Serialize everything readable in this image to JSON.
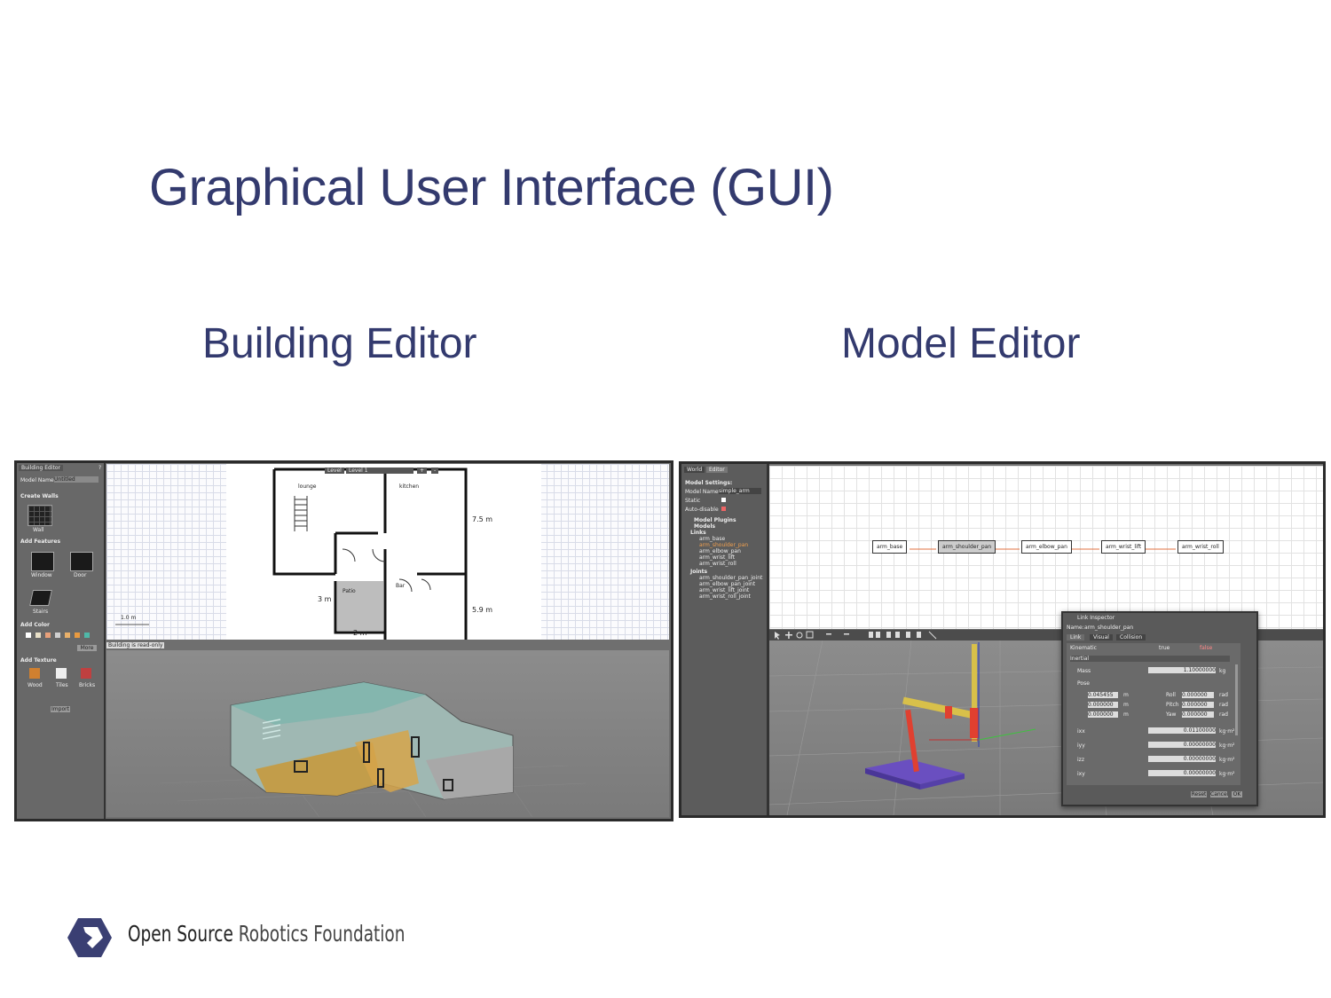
{
  "slide": {
    "title": "Graphical User Interface (GUI)",
    "left_caption": "Building Editor",
    "right_caption": "Model Editor"
  },
  "building_editor": {
    "tabs": [
      "Building Editor",
      "?"
    ],
    "model_name_label": "Model Name:",
    "model_name_value": "Untitled",
    "sections": {
      "create_walls": "Create Walls",
      "wall_item": "Wall",
      "add_features": "Add Features",
      "window": "Window",
      "door": "Door",
      "stairs": "Stairs",
      "add_color": "Add Color",
      "more_button": "More",
      "add_texture": "Add Texture",
      "textures": [
        "Wood",
        "Tiles",
        "Bricks"
      ],
      "import_button": "Import"
    },
    "level_controls": [
      "Level",
      "Level 1",
      "+",
      "-"
    ],
    "room_labels": [
      "lounge",
      "kitchen",
      "Patio",
      "Bar"
    ],
    "dimensions": [
      "7.5 m",
      "5.9 m",
      "3 m",
      "2 m"
    ],
    "scale_label": "1.0 m",
    "status": "Building is read-only",
    "colors": [
      "#ffffff",
      "#e9e0c8",
      "#e8a07a",
      "#d0d0d0",
      "#e8b06a",
      "#e89a40",
      "#4fb8a8"
    ]
  },
  "model_editor": {
    "tabs": [
      "World",
      "Editor"
    ],
    "settings_title": "Model Settings:",
    "model_name_label": "Model Name:",
    "model_name_value": "simple_arm",
    "static_label": "Static",
    "autodisable_label": "Auto-disable",
    "tree": {
      "model_plugins": "Model Plugins",
      "models": "Models",
      "links_label": "Links",
      "links": [
        "arm_base",
        "arm_shoulder_pan",
        "arm_elbow_pan",
        "arm_wrist_lift",
        "arm_wrist_roll"
      ],
      "joints_label": "Joints",
      "joints": [
        "arm_shoulder_pan_joint",
        "arm_elbow_pan_joint",
        "arm_wrist_lift_joint",
        "arm_wrist_roll_joint"
      ]
    },
    "graph_nodes": [
      "arm_base",
      "arm_shoulder_pan",
      "arm_elbow_pan",
      "arm_wrist_lift",
      "arm_wrist_roll"
    ],
    "inspector": {
      "title": "Link Inspector",
      "name_label": "Name:",
      "name_value": "arm_shoulder_pan",
      "tabs": [
        "Link",
        "Visual",
        "Collision"
      ],
      "kinematic_label": "Kinematic",
      "kinematic_options": [
        "true",
        "false"
      ],
      "inertial_label": "Inertial",
      "mass_label": "Mass",
      "mass_value": "1.10000000",
      "mass_unit": "kg",
      "pose_label": "Pose",
      "pose_xyz": [
        "0.045455",
        "0.000000",
        "0.000000"
      ],
      "pose_rpy": [
        "0.000000",
        "0.000000",
        "0.000000"
      ],
      "pose_rpy_labels": [
        "Roll",
        "Pitch",
        "Yaw"
      ],
      "unit_m": "m",
      "unit_rad": "rad",
      "inertia_rows": [
        {
          "label": "ixx",
          "value": "0.01100000",
          "unit": "kg·m²"
        },
        {
          "label": "iyy",
          "value": "0.00000000",
          "unit": "kg·m²"
        },
        {
          "label": "izz",
          "value": "0.00000000",
          "unit": "kg·m²"
        },
        {
          "label": "ixy",
          "value": "0.00000000",
          "unit": "kg·m²"
        }
      ],
      "buttons": [
        "Reset",
        "Cancel",
        "OK"
      ]
    }
  },
  "footer": {
    "org_bold": "Open Source",
    "org_light": "Robotics Foundation"
  }
}
